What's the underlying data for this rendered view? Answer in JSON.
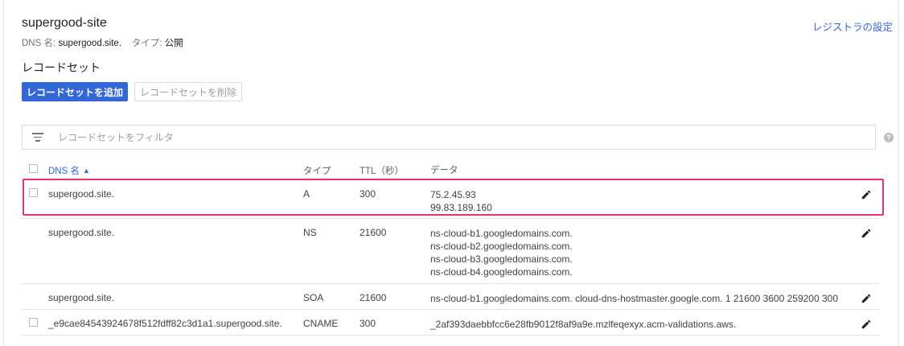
{
  "zone": {
    "title": "supergood-site",
    "dns_label": "DNS 名:",
    "dns_value": "supergood.site.",
    "type_label": "タイプ:",
    "type_value": "公開",
    "registrar_link": "レジストラの設定"
  },
  "section": {
    "title": "レコードセット",
    "add_button": "レコードセットを追加",
    "delete_button": "レコードセットを削除"
  },
  "filter": {
    "placeholder": "レコードセットをフィルタ"
  },
  "help_icon": "?",
  "table": {
    "headers": {
      "name": "DNS 名",
      "type": "タイプ",
      "ttl": "TTL（秒）",
      "data": "データ"
    },
    "sort_indicator": "▲",
    "rows": [
      {
        "name": "supergood.site.",
        "type": "A",
        "ttl": "300",
        "has_checkbox": true,
        "highlighted": true,
        "data": [
          "75.2.45.93",
          "99.83.189.160"
        ]
      },
      {
        "name": "supergood.site.",
        "type": "NS",
        "ttl": "21600",
        "has_checkbox": false,
        "data": [
          "ns-cloud-b1.googledomains.com.",
          "ns-cloud-b2.googledomains.com.",
          "ns-cloud-b3.googledomains.com.",
          "ns-cloud-b4.googledomains.com."
        ]
      },
      {
        "name": "supergood.site.",
        "type": "SOA",
        "ttl": "21600",
        "has_checkbox": false,
        "data": [
          "ns-cloud-b1.googledomains.com. cloud-dns-hostmaster.google.com. 1 21600 3600 259200 300"
        ]
      },
      {
        "name": "_e9cae84543924678f512fdff82c3d1a1.supergood.site.",
        "type": "CNAME",
        "ttl": "300",
        "has_checkbox": true,
        "data": [
          "_2af393daebbfcc6e28fb9012f8af9a9e.mzlfeqexyx.acm-validations.aws."
        ]
      }
    ]
  },
  "colors": {
    "accent": "#3367d6",
    "highlight": "#e8336f"
  }
}
